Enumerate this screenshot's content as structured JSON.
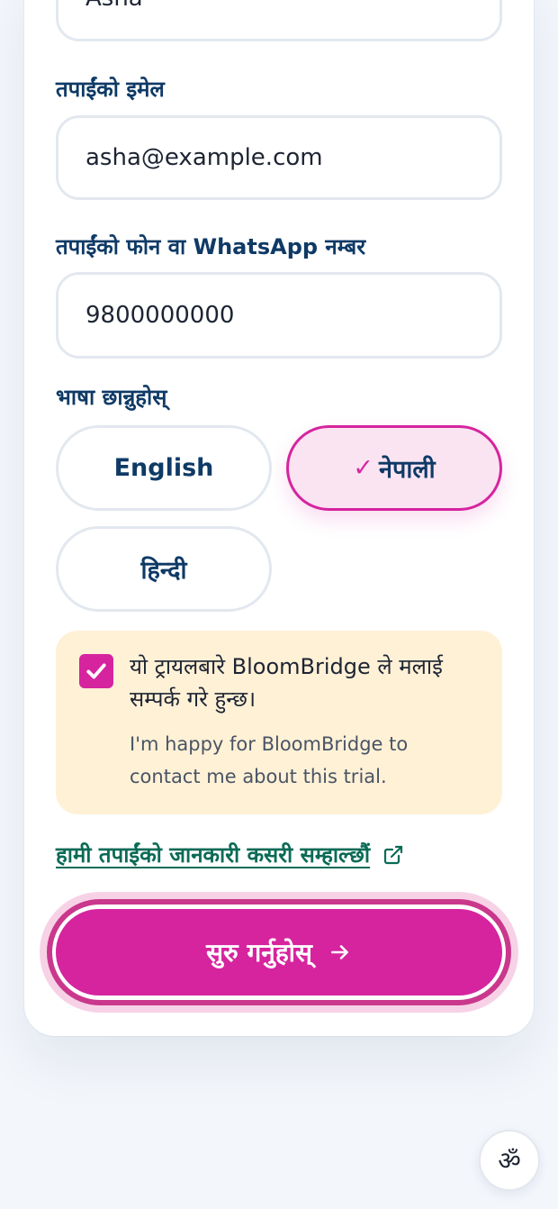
{
  "form": {
    "name_value": "Asha",
    "email_label": "तपाईंको इमेल",
    "email_value": "asha@example.com",
    "phone_label": "तपाईंको फोन वा WhatsApp नम्बर",
    "phone_value": "9800000000",
    "language_label": "भाषा छान्नुहोस्",
    "languages": [
      {
        "label": "English",
        "selected": false
      },
      {
        "label": "नेपाली",
        "selected": true
      },
      {
        "label": "हिन्दी",
        "selected": false
      }
    ],
    "selected_check": "✓",
    "consent_text": "यो ट्रायलबारे BloomBridge ले मलाई सम्पर्क गरे हुन्छ।",
    "consent_subtext": "I'm happy for BloomBridge to contact me about this trial.",
    "consent_checked": true,
    "privacy_link": "हामी तपाईंको जानकारी कसरी सम्हाल्छौं",
    "submit_label": "सुरु गर्नुहोस्"
  },
  "language_fab": {
    "glyph": "ॐ"
  },
  "colors": {
    "accent": "#d6249f",
    "label": "#0f3a66",
    "link": "#0a6b56",
    "consent_bg": "#fff1d6"
  }
}
